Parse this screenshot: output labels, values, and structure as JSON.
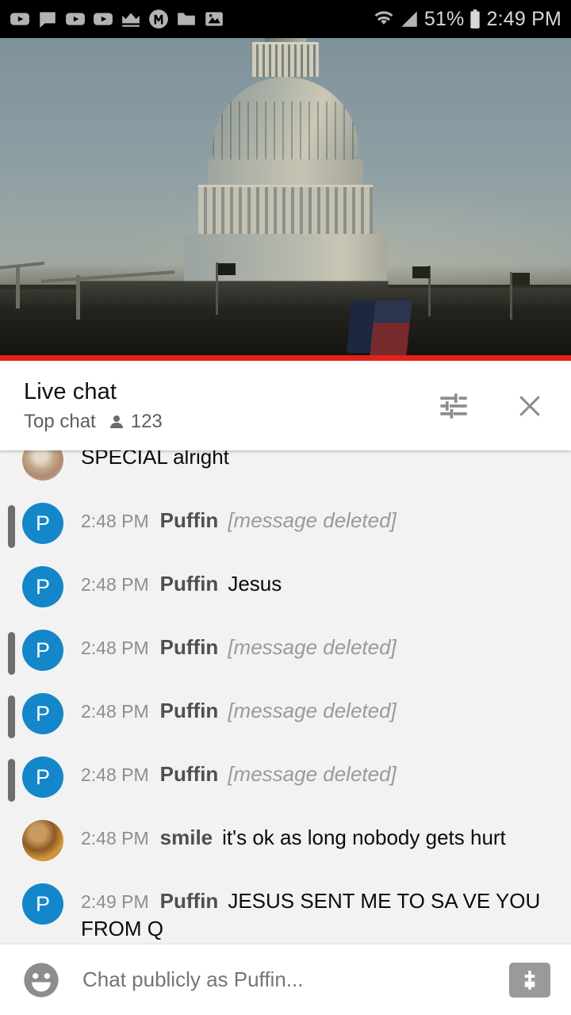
{
  "status_bar": {
    "left_icons": [
      "youtube-play-icon",
      "chat-bubble-icon",
      "youtube-play-icon",
      "youtube-play-icon",
      "crown-icon",
      "m-circle-icon",
      "folder-icon",
      "image-icon"
    ],
    "wifi_icon": "wifi-icon",
    "signal_icon": "cell-signal-icon",
    "battery_percent": "51%",
    "battery_icon": "battery-icon",
    "time": "2:49 PM"
  },
  "video": {
    "name": "us-capitol-live-stream",
    "progress_color": "#e52117",
    "progress_percent": 100
  },
  "chat_header": {
    "title": "Live chat",
    "subtitle": "Top chat",
    "viewer_icon": "person-icon",
    "viewer_count": "123",
    "settings_icon": "tune-icon",
    "close_icon": "close-icon"
  },
  "messages": [
    {
      "avatar_type": "photo-special",
      "avatar_letter": "",
      "timestamp": "",
      "author": "",
      "text": "SPECIAL alright",
      "deleted": false,
      "clipped": true
    },
    {
      "avatar_type": "letter-blue",
      "avatar_letter": "P",
      "timestamp": "2:48 PM",
      "author": "Puffin",
      "text": "[message deleted]",
      "deleted": true,
      "clipped": false
    },
    {
      "avatar_type": "letter-blue",
      "avatar_letter": "P",
      "timestamp": "2:48 PM",
      "author": "Puffin",
      "text": "Jesus",
      "deleted": false,
      "clipped": false
    },
    {
      "avatar_type": "letter-blue",
      "avatar_letter": "P",
      "timestamp": "2:48 PM",
      "author": "Puffin",
      "text": "[message deleted]",
      "deleted": true,
      "clipped": false
    },
    {
      "avatar_type": "letter-blue",
      "avatar_letter": "P",
      "timestamp": "2:48 PM",
      "author": "Puffin",
      "text": "[message deleted]",
      "deleted": true,
      "clipped": false
    },
    {
      "avatar_type": "letter-blue",
      "avatar_letter": "P",
      "timestamp": "2:48 PM",
      "author": "Puffin",
      "text": "[message deleted]",
      "deleted": true,
      "clipped": false
    },
    {
      "avatar_type": "photo-smile",
      "avatar_letter": "",
      "timestamp": "2:48 PM",
      "author": "smile",
      "text": "it's ok as long nobody gets hurt",
      "deleted": false,
      "clipped": false
    },
    {
      "avatar_type": "letter-blue",
      "avatar_letter": "P",
      "timestamp": "2:49 PM",
      "author": "Puffin",
      "text": "JESUS SENT ME TO SA VE YOU FROM Q",
      "deleted": false,
      "clipped": false
    }
  ],
  "composer": {
    "emoji_icon": "emoji-smiley-icon",
    "placeholder": "Chat publicly as Puffin...",
    "input_value": "",
    "superchat_icon": "dollar-icon"
  },
  "colors": {
    "avatar_blue": "#1387c9",
    "progress_red": "#e52117",
    "chat_background": "#f2f2f2"
  }
}
